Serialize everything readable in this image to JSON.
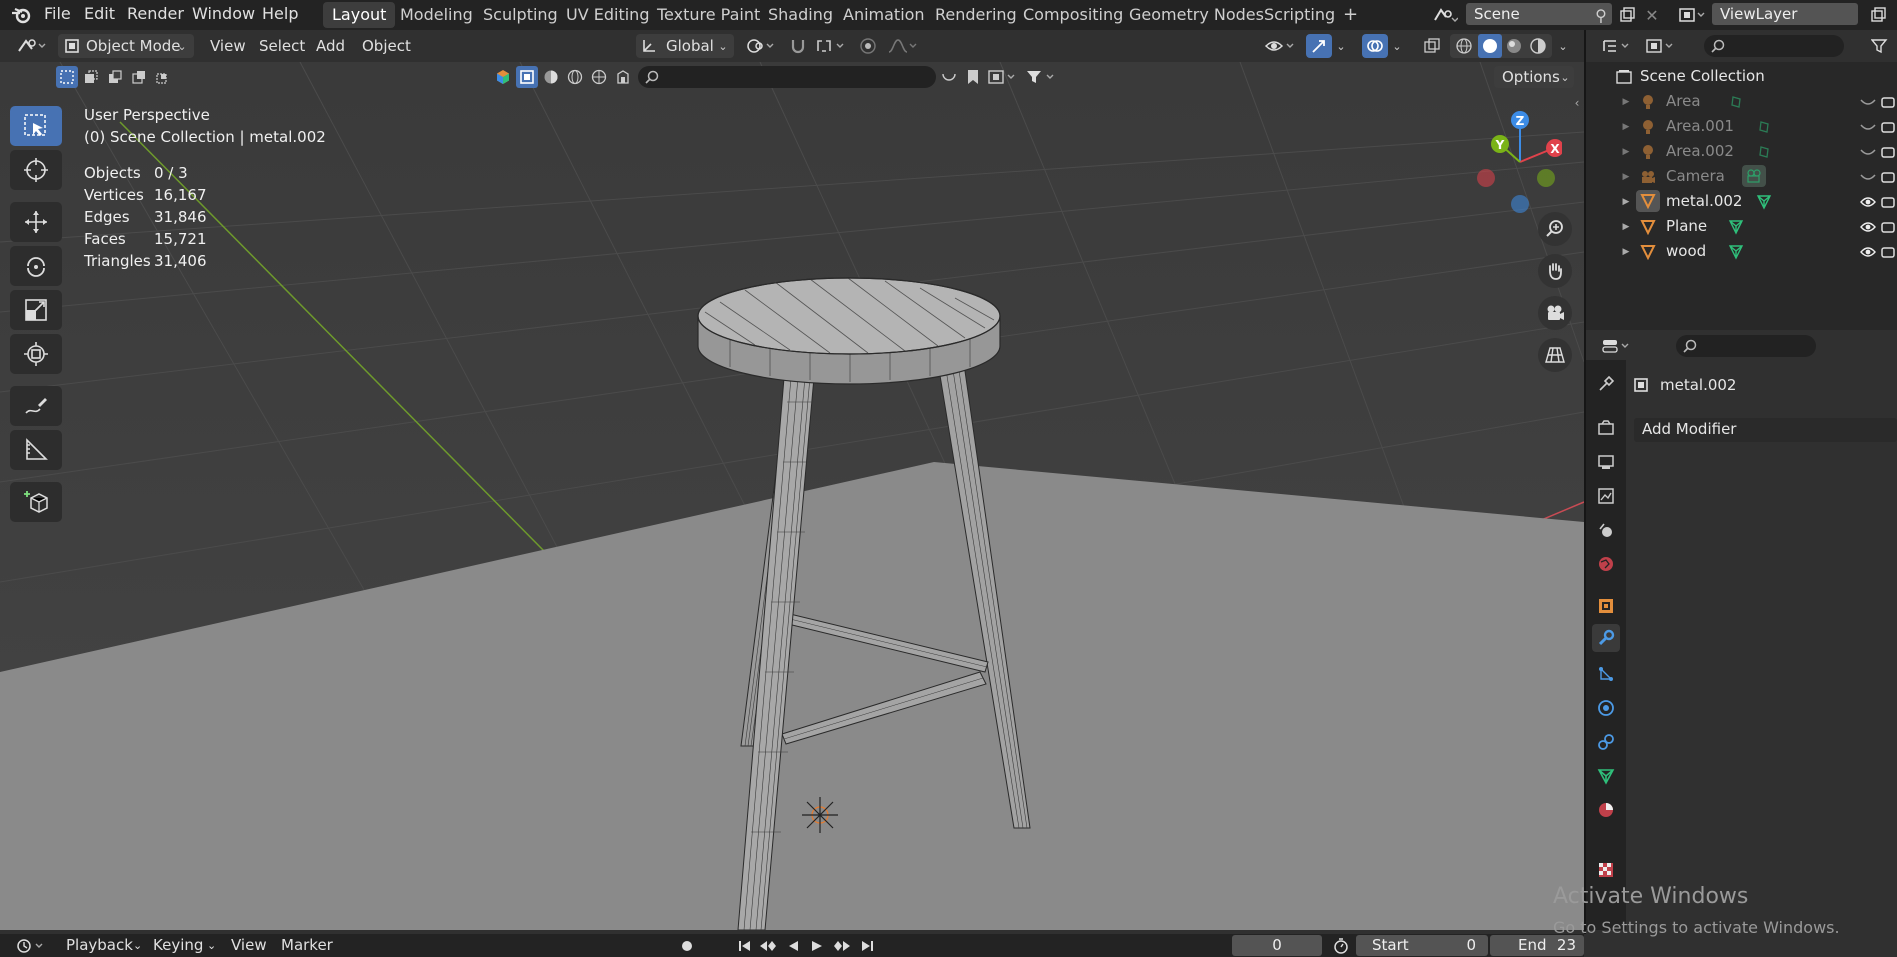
{
  "menu": {
    "items": [
      "File",
      "Edit",
      "Render",
      "Window",
      "Help"
    ],
    "workspaces": [
      "Layout",
      "Modeling",
      "Sculpting",
      "UV Editing",
      "Texture Paint",
      "Shading",
      "Animation",
      "Rendering",
      "Compositing",
      "Geometry Nodes",
      "Scripting"
    ],
    "active_workspace": "Layout",
    "add_workspace": "+",
    "scene": "Scene",
    "view_layer": "ViewLayer"
  },
  "header": {
    "mode": "Object Mode",
    "view": "View",
    "select": "Select",
    "add": "Add",
    "object": "Object",
    "orientation": "Global",
    "options": "Options"
  },
  "viewport": {
    "perspective": "User Perspective",
    "collection": "(0) Scene Collection | metal.002",
    "stats": [
      {
        "label": "Objects",
        "value": "0 / 3"
      },
      {
        "label": "Vertices",
        "value": "16,167"
      },
      {
        "label": "Edges",
        "value": "31,846"
      },
      {
        "label": "Faces",
        "value": "15,721"
      },
      {
        "label": "Triangles",
        "value": "31,406"
      }
    ],
    "gizmo": {
      "x": "X",
      "y": "Y",
      "z": "Z"
    }
  },
  "outliner": {
    "root": "Scene Collection",
    "items": [
      {
        "name": "Area",
        "type": "light",
        "visible": false
      },
      {
        "name": "Area.001",
        "type": "light",
        "visible": false
      },
      {
        "name": "Area.002",
        "type": "light",
        "visible": false
      },
      {
        "name": "Camera",
        "type": "camera",
        "visible": false
      },
      {
        "name": "metal.002",
        "type": "mesh",
        "visible": true
      },
      {
        "name": "Plane",
        "type": "mesh",
        "visible": true
      },
      {
        "name": "wood",
        "type": "mesh",
        "visible": true
      }
    ]
  },
  "properties": {
    "object_name": "metal.002",
    "add_modifier": "Add Modifier"
  },
  "timeline": {
    "playback": "Playback",
    "keying": "Keying",
    "view": "View",
    "marker": "Marker",
    "current_frame": "0",
    "start_label": "Start",
    "start": "0",
    "end_label": "End",
    "end": "23"
  },
  "watermark": {
    "title": "Activate Windows",
    "subtitle": "Go to Settings to activate Windows."
  },
  "colors": {
    "accent": "#4772b3",
    "axis_x": "#e0424b",
    "axis_y": "#7ab317",
    "axis_z": "#3c8ce6",
    "mesh_orange": "#e38e3c",
    "mesh_green": "#2fbf7a"
  }
}
